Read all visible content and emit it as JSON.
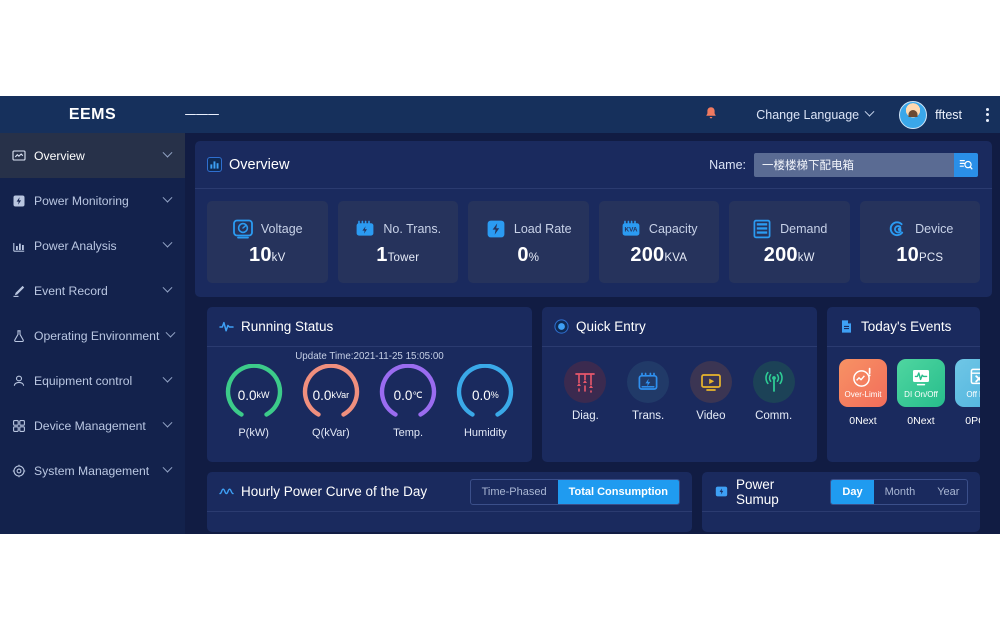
{
  "topbar": {
    "brand": "EEMS",
    "menu_icon": "hamburger-icon",
    "bell_icon": "bell-icon",
    "language_label": "Change Language",
    "username": "fftest",
    "more_icon": "kebab-menu-icon"
  },
  "sidebar": {
    "items": [
      {
        "label": "Overview",
        "icon": "monitor-chart-icon",
        "active": true
      },
      {
        "label": "Power Monitoring",
        "icon": "bolt-square-icon",
        "active": false
      },
      {
        "label": "Power Analysis",
        "icon": "bar-chart-icon",
        "active": false
      },
      {
        "label": "Event Record",
        "icon": "pen-icon",
        "active": false
      },
      {
        "label": "Operating Environment",
        "icon": "flask-icon",
        "active": false
      },
      {
        "label": "Equipment control",
        "icon": "device-control-icon",
        "active": false
      },
      {
        "label": "Device Management",
        "icon": "grid-squares-icon",
        "active": false
      },
      {
        "label": "System Management",
        "icon": "gear-icon",
        "active": false
      }
    ]
  },
  "overview": {
    "title": "Overview",
    "icon": "bar-chart-icon",
    "name_label": "Name:",
    "search_value": "一楼楼梯下配电箱",
    "search_placeholder": "一楼楼梯下配电箱",
    "search_button_icon": "search-list-icon",
    "kpis": [
      {
        "name": "Voltage",
        "value": "10",
        "unit": "kV",
        "icon": "gauge-meter-icon"
      },
      {
        "name": "No. Trans.",
        "value": "1",
        "unit": "Tower",
        "icon": "transformer-icon"
      },
      {
        "name": "Load Rate",
        "value": "0",
        "unit": "%",
        "icon": "bolt-square-icon"
      },
      {
        "name": "Capacity",
        "value": "200",
        "unit": "KVA",
        "icon": "kva-icon"
      },
      {
        "name": "Demand",
        "value": "200",
        "unit": "kW",
        "icon": "server-rack-icon"
      },
      {
        "name": "Device",
        "value": "10",
        "unit": "PCS",
        "icon": "target-device-icon"
      }
    ]
  },
  "running_status": {
    "title": "Running Status",
    "icon": "pulse-icon",
    "update_time": "Update Time:2021-11-25 15:05:00",
    "gauges": [
      {
        "label": "P(kW)",
        "value": "0.0",
        "unit": "kW",
        "color": "#3ccb8a"
      },
      {
        "label": "Q(kVar)",
        "value": "0.0",
        "unit": "kVar",
        "color": "#f08f7e"
      },
      {
        "label": "Temp.",
        "value": "0.0",
        "unit": "℃",
        "color": "#9a6cf0"
      },
      {
        "label": "Humidity",
        "value": "0.0",
        "unit": "%",
        "color": "#3aa9e8"
      }
    ]
  },
  "quick_entry": {
    "title": "Quick Entry",
    "icon": "info-circle-icon",
    "items": [
      {
        "label": "Diag.",
        "icon": "diagram-lines-icon",
        "color": "#e8576b",
        "bg": "#3b2a4f"
      },
      {
        "label": "Trans.",
        "icon": "transformer-icon",
        "color": "#2f90ef",
        "bg": "#213a68"
      },
      {
        "label": "Video",
        "icon": "video-play-icon",
        "color": "#e9b52c",
        "bg": "#3b3553"
      },
      {
        "label": "Comm.",
        "icon": "signal-antenna-icon",
        "color": "#2ecb94",
        "bg": "#1c4257"
      }
    ]
  },
  "todays_events": {
    "title": "Today's Events",
    "icon": "document-icon",
    "items": [
      {
        "tile_label": "Over-Limit",
        "count": "0",
        "unit": "Next",
        "icon": "over-limit-icon",
        "color1": "#f79264",
        "color2": "#f26d5b"
      },
      {
        "tile_label": "DI On/Off",
        "count": "0",
        "unit": "Next",
        "icon": "waveform-monitor-icon",
        "color1": "#4fd6a0",
        "color2": "#27bd8c"
      },
      {
        "tile_label": "Off line",
        "count": "0",
        "unit": "PCS",
        "icon": "window-x-icon",
        "color1": "#6fc6e6",
        "color2": "#4fb3dd"
      }
    ]
  },
  "hourly_curve": {
    "title": "Hourly Power Curve of the Day",
    "icon": "wave-icon",
    "tabs": [
      {
        "label": "Time-Phased",
        "active": false
      },
      {
        "label": "Total Consumption",
        "active": true
      }
    ]
  },
  "power_sumup": {
    "title": "Power Sumup",
    "icon": "plug-bolt-icon",
    "tabs": [
      {
        "label": "Day",
        "active": true
      },
      {
        "label": "Month",
        "active": false
      },
      {
        "label": "Year",
        "active": false
      }
    ]
  },
  "colors": {
    "header_bg": "#16305c",
    "sidebar_bg": "#13224c",
    "content_bg": "#111c43",
    "panel_bg": "#1a2a5e",
    "kpi_bg": "#26335c",
    "accent": "#1f9bf0"
  }
}
